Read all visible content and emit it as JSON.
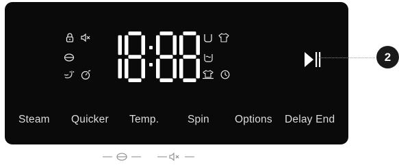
{
  "display": {
    "time": "18:88",
    "colors": {
      "panel": "#0a0a0a",
      "segment": "#ffffff",
      "icon": "#e8e8e8",
      "label": "#dcdcdc"
    }
  },
  "left_icons": [
    "child-lock-icon",
    "mute-icon",
    "eco-icon",
    "hand-wash-icon",
    "quick-wash-icon"
  ],
  "right_icons": [
    "prewash-tub-icon",
    "shirt-icon",
    "rinse-hold-icon",
    "wool-icon",
    "delay-clock-icon"
  ],
  "buttons": {
    "steam": "Steam",
    "quicker": "Quicker",
    "temp": "Temp.",
    "spin": "Spin",
    "options": "Options",
    "delay_end": "Delay End"
  },
  "start_pause": {
    "icon": "play-pause-icon"
  },
  "callout": {
    "number": "2"
  },
  "legend_icons": [
    "eco-icon",
    "mute-icon"
  ]
}
